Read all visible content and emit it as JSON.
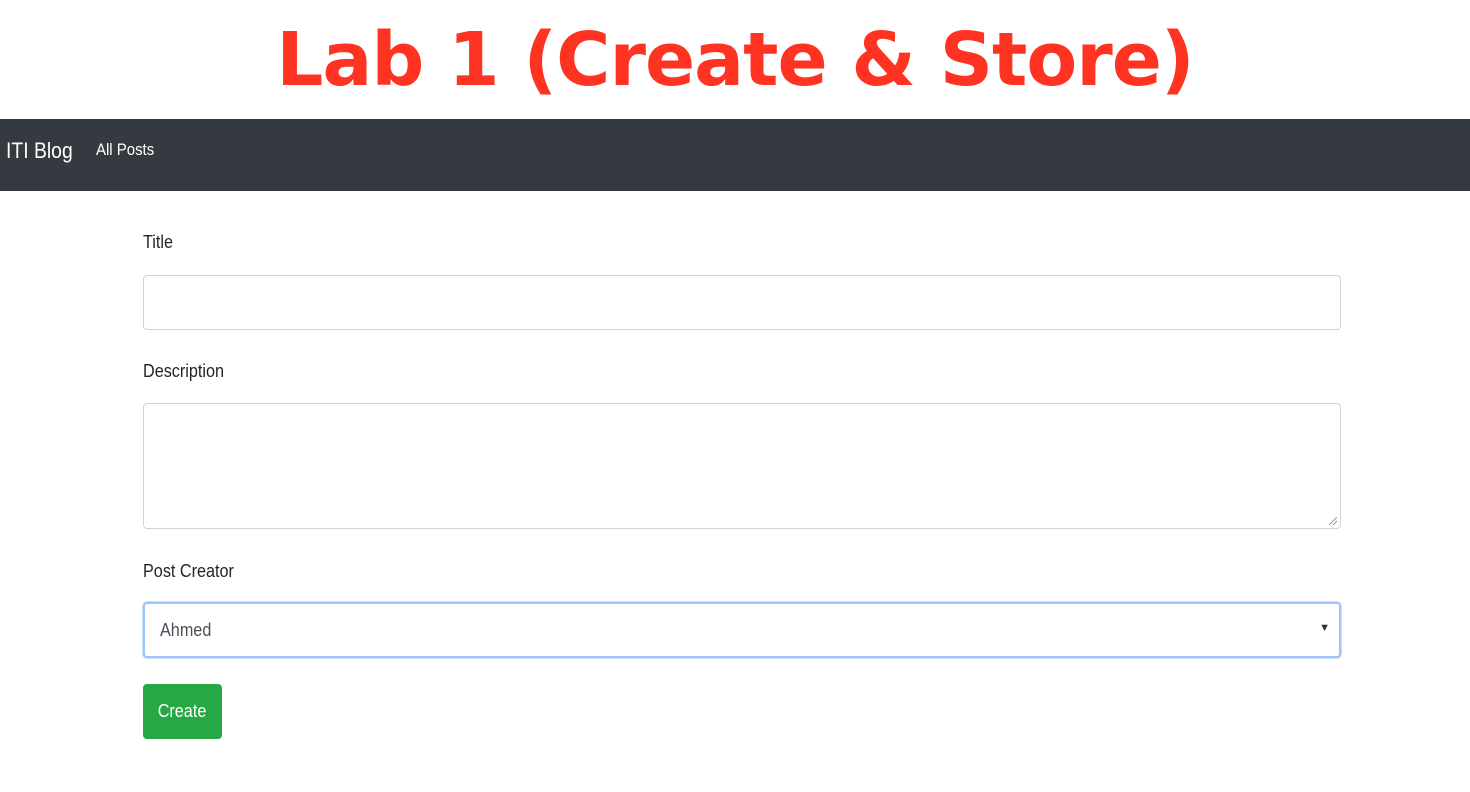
{
  "slide": {
    "title": "Lab 1 (Create & Store)"
  },
  "navbar": {
    "brand": "ITI Blog",
    "links": [
      "All Posts"
    ]
  },
  "form": {
    "title_label": "Title",
    "title_value": "",
    "description_label": "Description",
    "description_value": "",
    "creator_label": "Post Creator",
    "creator_selected": "Ahmed",
    "submit_label": "Create"
  },
  "icons": {
    "dropdown": "chevron-down-icon",
    "textarea_resize": "resize-grip-icon"
  },
  "colors": {
    "title_accent": "#ff3322",
    "navbar_bg": "#343a40",
    "create_button": "#28a745",
    "select_focus": "#9ec5f7"
  }
}
